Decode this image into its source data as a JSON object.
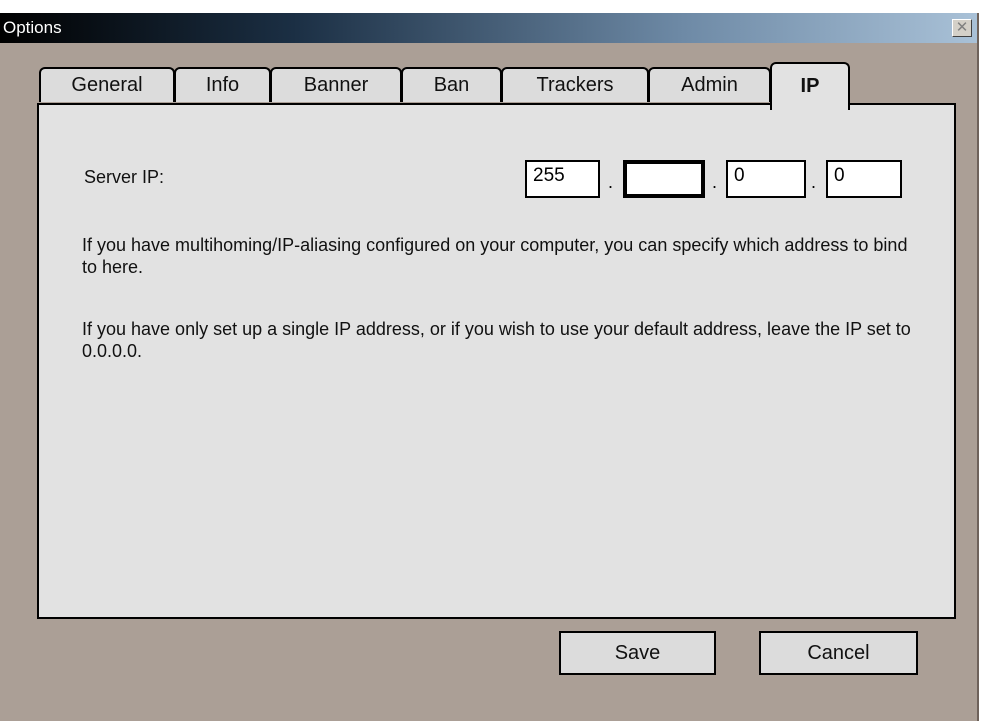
{
  "window": {
    "title": "Options",
    "close_icon": "close-icon"
  },
  "tabs": [
    {
      "label": "General",
      "active": false
    },
    {
      "label": "Info",
      "active": false
    },
    {
      "label": "Banner",
      "active": false
    },
    {
      "label": "Ban",
      "active": false
    },
    {
      "label": "Trackers",
      "active": false
    },
    {
      "label": "Admin",
      "active": false
    },
    {
      "label": "IP",
      "active": true
    }
  ],
  "ip_panel": {
    "server_ip_label": "Server IP:",
    "octets": [
      "255",
      "",
      "0",
      "0"
    ],
    "separator": ".",
    "paragraph1": "If you have multihoming/IP-aliasing configured on your computer, you can specify which address to bind to here.",
    "paragraph2": "If you have only set up a single IP address, or if you wish to use your default address, leave the IP set to 0.0.0.0."
  },
  "buttons": {
    "save": "Save",
    "cancel": "Cancel"
  }
}
